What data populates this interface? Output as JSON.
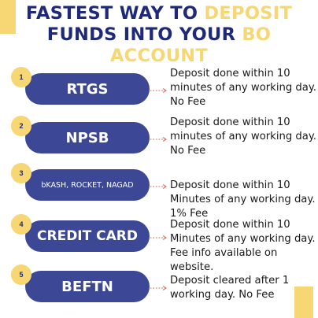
{
  "title": {
    "part1": "FASTEST WAY TO ",
    "part2": "DEPOSIT",
    "part3": "FUNDS INTO YOUR ",
    "part4": "BO",
    "part5": "ACCOUNT"
  },
  "colors": {
    "navy": "#1e2a78",
    "pill": "#3c4895",
    "accent": "#f7d674",
    "arrow": "#e8776b"
  },
  "steps": [
    {
      "number": "1",
      "label": "RTGS",
      "desc": "Deposit done within 10 minutes of any working day. No Fee"
    },
    {
      "number": "2",
      "label": "NPSB",
      "desc": "Deposit done within 10 minutes of any working day. No Fee"
    },
    {
      "number": "3",
      "label": "bKASH, ROCKET, NAGAD",
      "desc": "Deposit done within 10 Minutes of any working day. 1% Fee"
    },
    {
      "number": "4",
      "label": "CREDIT CARD",
      "desc": "Deposit done within 10 Minutes of any working day. Fee info available on website."
    },
    {
      "number": "5",
      "label": "BEFTN",
      "desc": "Deposit cleared after 1 working day. No Fee"
    }
  ]
}
